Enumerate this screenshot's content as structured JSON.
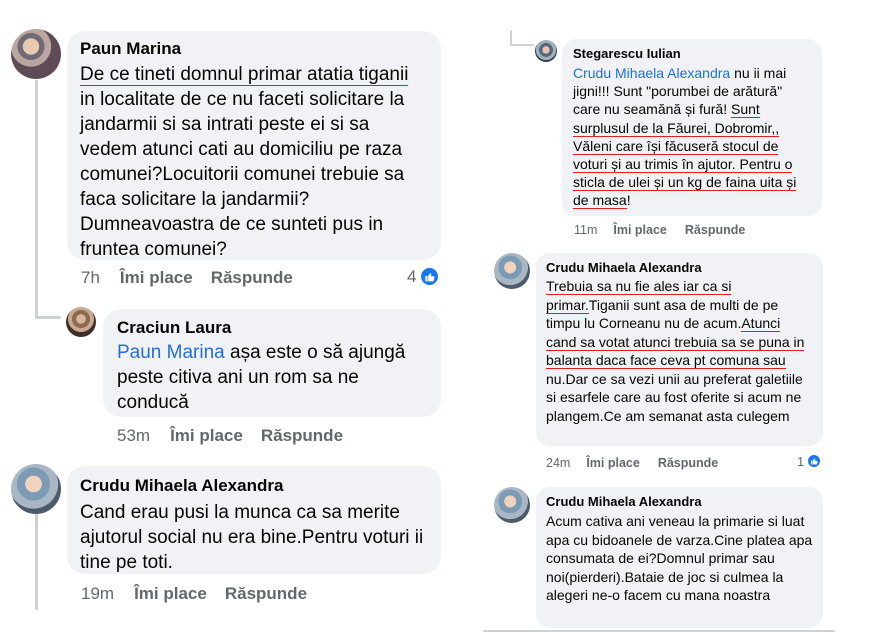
{
  "left": {
    "comments": [
      {
        "author": "Paun Marina",
        "segments": [
          {
            "text": "De ce tineti domnul primar atatia tiganii",
            "style": "underline"
          },
          {
            "text": " in localitate de ce nu faceti solicitare la jandarmii si sa intrati peste ei si sa vedem atunci cati au domiciliu pe raza comunei?Locuitorii comunei trebuie sa faca solicitare la jandarmii? Dumneavoastra de ce sunteti pus in fruntea comunei?",
            "style": "plain"
          }
        ],
        "time": "7h",
        "like": "Îmi place",
        "reply": "Răspunde",
        "reactions": "4"
      },
      {
        "author": "Craciun Laura",
        "segments": [
          {
            "text": "Paun Marina",
            "style": "mention"
          },
          {
            "text": " așa este o să ajungă peste citiva ani un rom sa ne conducă",
            "style": "plain"
          }
        ],
        "time": "53m",
        "like": "Îmi place",
        "reply": "Răspunde"
      },
      {
        "author": "Crudu Mihaela Alexandra",
        "segments": [
          {
            "text": "Cand erau pusi la munca ca sa merite ajutorul social nu era bine.Pentru voturi ii tine pe toti.",
            "style": "plain"
          }
        ],
        "time": "19m",
        "like": "Îmi place",
        "reply": "Răspunde"
      }
    ]
  },
  "right": {
    "comments": [
      {
        "author": "Stegarescu Iulian",
        "segments": [
          {
            "text": "Crudu Mihaela Alexandra",
            "style": "mention"
          },
          {
            "text": " nu ii mai jigni!!! Sunt \"porumbei de arătură\" care nu seamănă și fură! ",
            "style": "plain"
          },
          {
            "text": "Sunt surplusul de la Făurei, Dobromir,, Văleni care își făcuseră stocul de voturi și au trimis în ajutor. Pentru o sticla de ulei și un kg de faina uita și de masa",
            "style": "underline"
          },
          {
            "text": "!",
            "style": "plain"
          }
        ],
        "time": "11m",
        "like": "Îmi place",
        "reply": "Răspunde"
      },
      {
        "author": "Crudu Mihaela Alexandra",
        "segments": [
          {
            "text": "Trebuia sa nu fie ales iar ca si primar.",
            "style": "underline"
          },
          {
            "text": "Tiganii sunt asa de multi de pe timpu lu Corneanu nu de acum.",
            "style": "plain"
          },
          {
            "text": "Atunci cand sa votat atunci trebuia sa se puna in balanta daca face ceva pt comuna sau",
            "style": "underline"
          },
          {
            "text": " nu.Dar ce sa vezi unii au preferat galetiile si esarfele care au fost oferite si acum ne plangem.Ce am semanat asta culegem",
            "style": "plain"
          }
        ],
        "time": "24m",
        "like": "Îmi place",
        "reply": "Răspunde",
        "reactions": "1"
      },
      {
        "author": "Crudu Mihaela Alexandra",
        "segments": [
          {
            "text": "Acum cativa ani veneau la primarie si luat apa cu bidoanele de varza.Cine platea apa consumata de ei?Domnul primar sau noi(pierderi).Bataie de joc si culmea la alegeri ne-o facem cu mana noastra",
            "style": "plain"
          }
        ]
      }
    ]
  },
  "icons": {
    "like": "thumbs-up-icon"
  },
  "colors": {
    "mention": "#216fdb",
    "bubble": "#f0f2f5",
    "meta": "#65676b",
    "underline": "#e02020",
    "like_badge": "#1877f2"
  }
}
